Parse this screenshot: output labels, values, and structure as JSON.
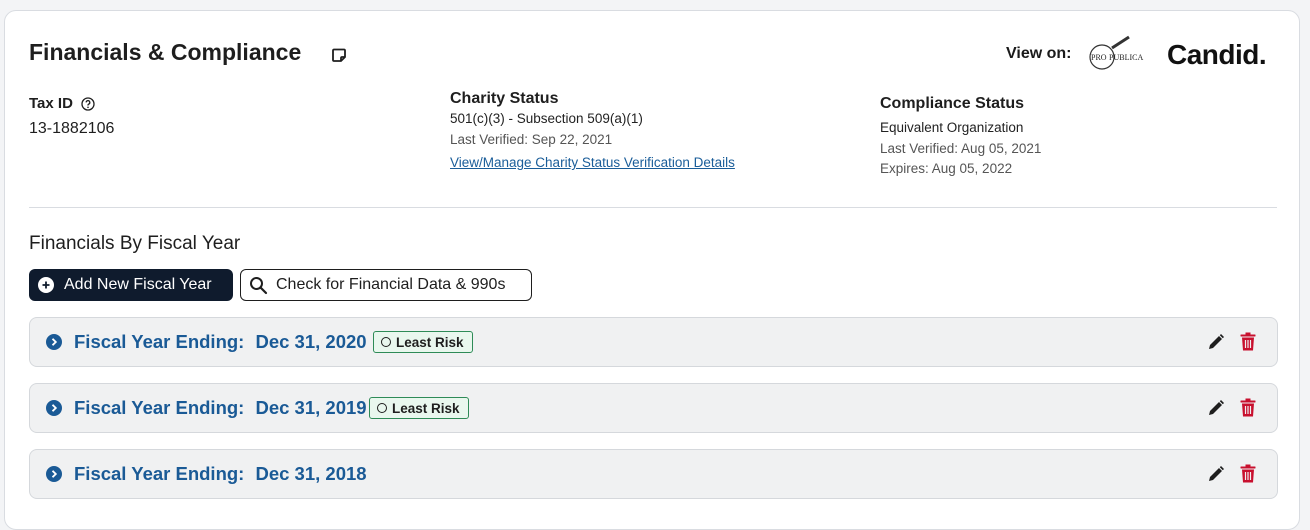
{
  "header": {
    "title": "Financials & Compliance",
    "view_on_label": "View on:",
    "propublica_logo_text": "ProPublica",
    "candid_logo_text": "Candid."
  },
  "tax": {
    "label": "Tax ID",
    "value": "13-1882106"
  },
  "charity": {
    "label": "Charity Status",
    "status": "501(c)(3) - Subsection 509(a)(1)",
    "last_verified": "Last Verified: Sep 22, 2021",
    "link": "View/Manage Charity Status Verification Details"
  },
  "compliance": {
    "label": "Compliance Status",
    "status": "Equivalent Organization",
    "last_verified": "Last Verified: Aug 05, 2021",
    "expires": "Expires: Aug 05, 2022"
  },
  "financials": {
    "section_title": "Financials By Fiscal Year",
    "add_button": "Add New Fiscal Year",
    "check_button": "Check for Financial Data & 990s",
    "rows": [
      {
        "prefix": "Fiscal Year Ending:",
        "date": "Dec 31, 2020",
        "badge": "Least Risk"
      },
      {
        "prefix": "Fiscal Year Ending:",
        "date": "Dec 31, 2019",
        "badge": "Least Risk"
      },
      {
        "prefix": "Fiscal Year Ending:",
        "date": "Dec 31, 2018",
        "badge": ""
      }
    ]
  },
  "colors": {
    "accent_blue": "#1a5a96",
    "dark_button": "#0f1b2d",
    "delete_red": "#c8102e",
    "badge_green": "#2e8b57"
  }
}
